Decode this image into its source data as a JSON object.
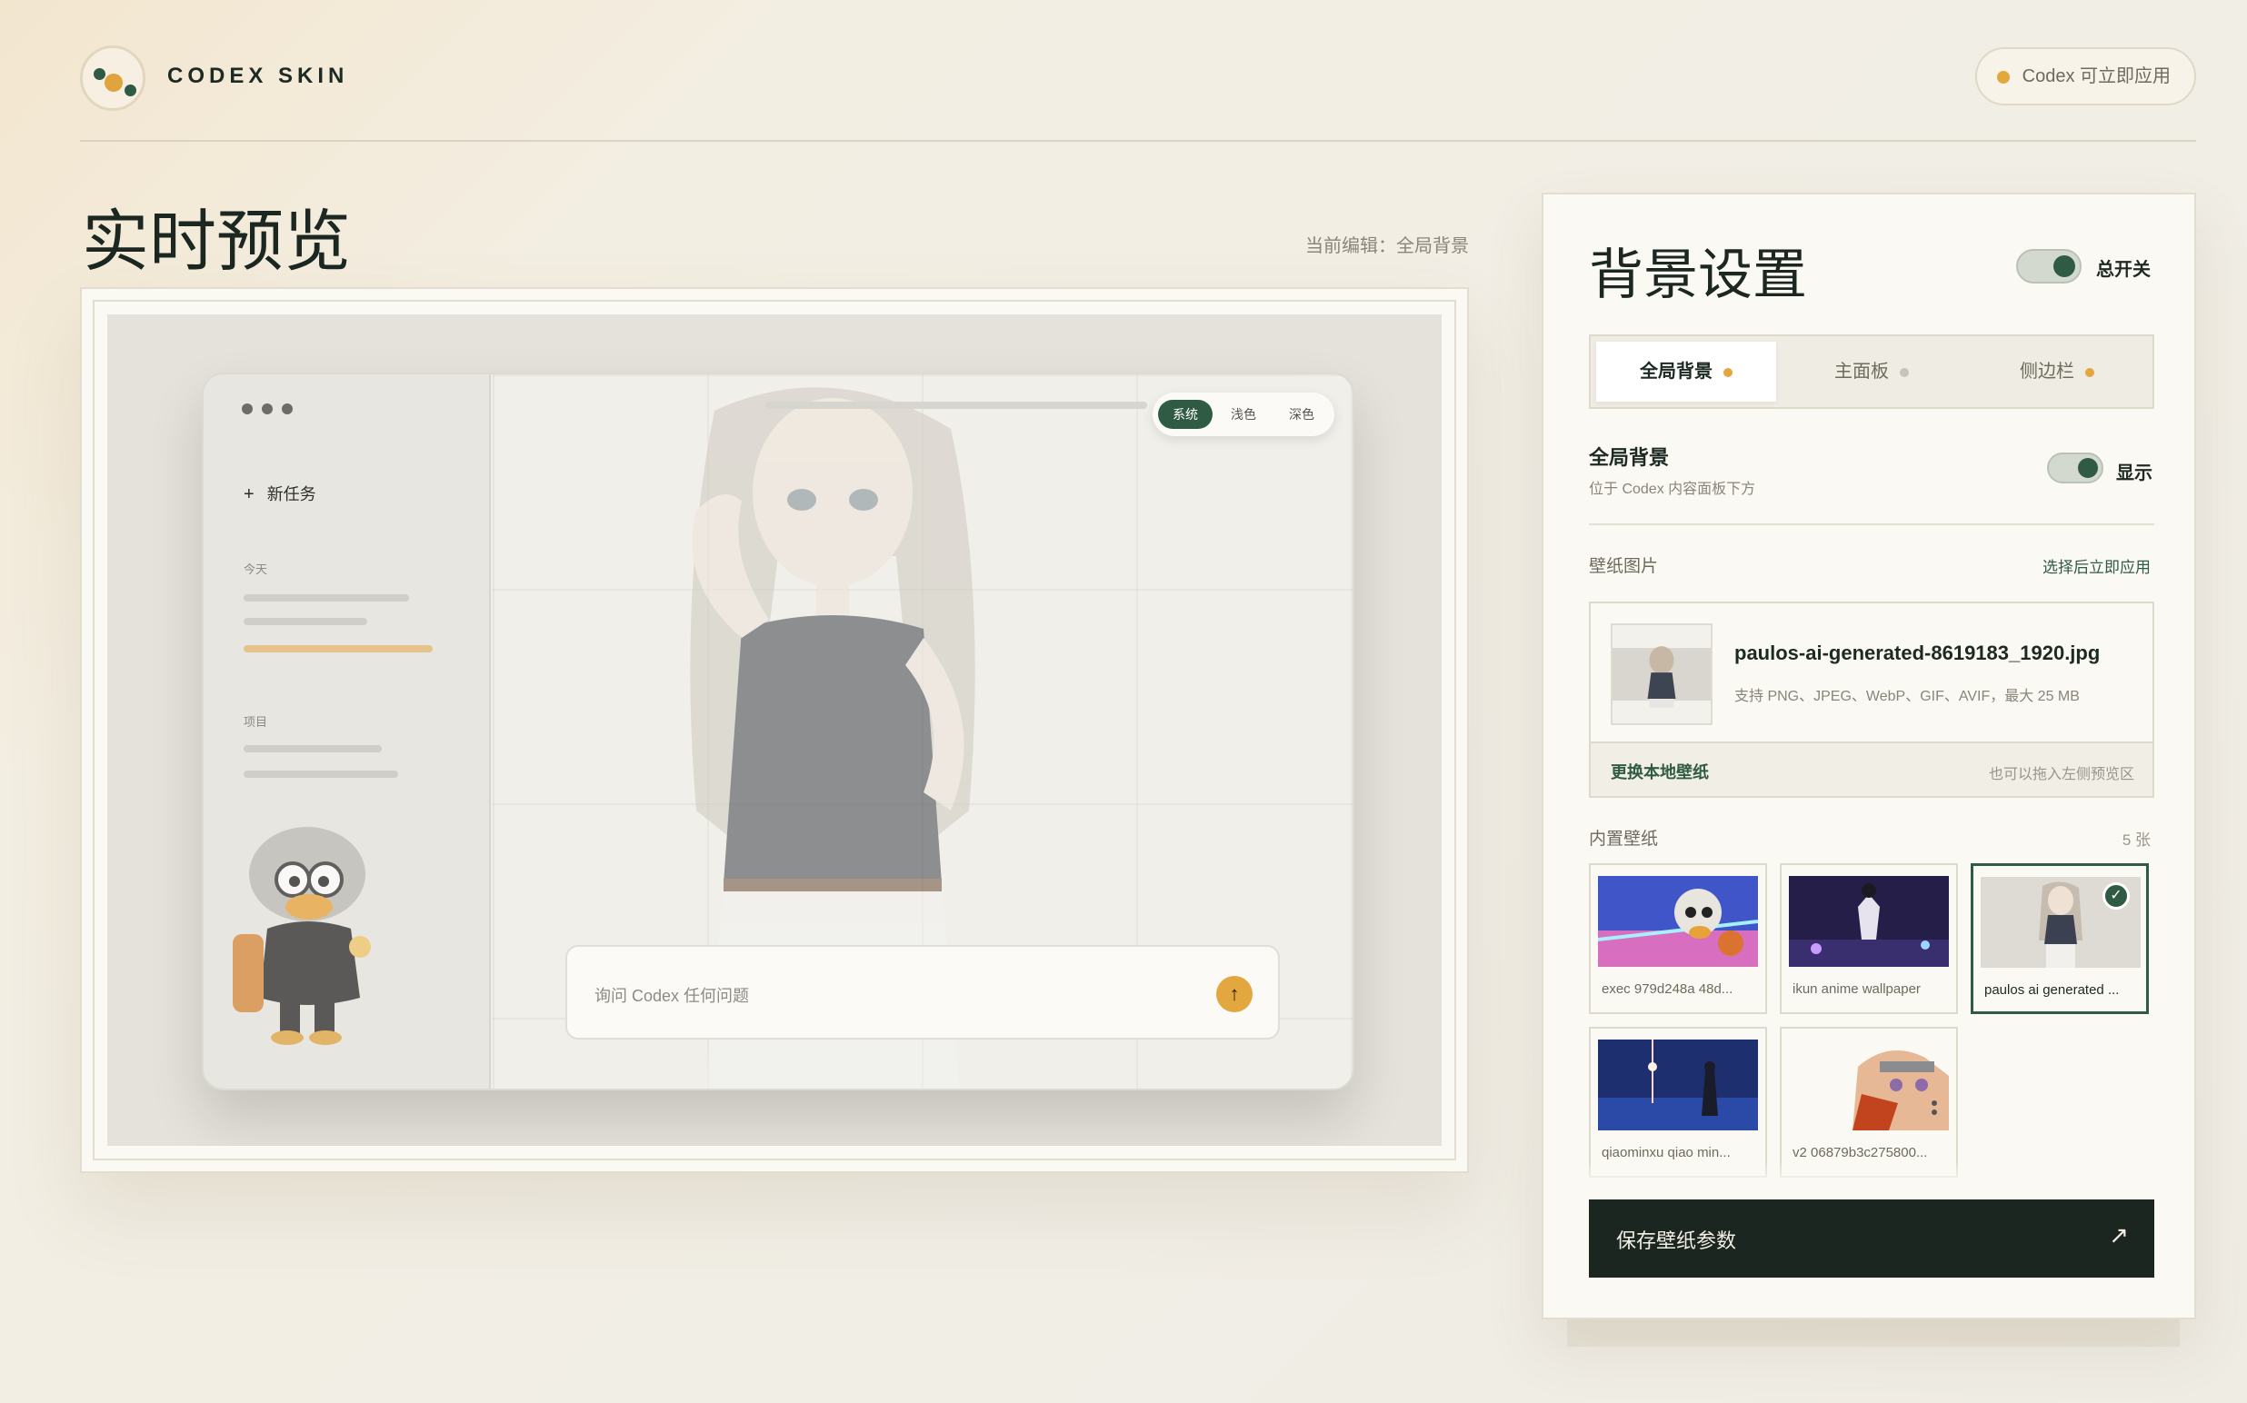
{
  "header": {
    "brand": "CODEX SKIN",
    "status": "Codex 可立即应用"
  },
  "preview": {
    "title": "实时预览",
    "editing": "当前编辑：全局背景",
    "mock": {
      "new_task": "新任务",
      "today_label": "今天",
      "projects_label": "项目",
      "theme_options": [
        "系统",
        "浅色",
        "深色"
      ],
      "ask_placeholder": "询问 Codex 任何问题",
      "send_icon": "↑"
    }
  },
  "panel": {
    "title": "背景设置",
    "master_toggle_label": "总开关",
    "tabs": [
      {
        "label": "全局背景",
        "dot_color": "#e3a740"
      },
      {
        "label": "主面板",
        "dot_color": "#c8c4ba"
      },
      {
        "label": "侧边栏",
        "dot_color": "#e3a740"
      }
    ],
    "global_bg": {
      "title": "全局背景",
      "subtitle": "位于 Codex 内容面板下方",
      "toggle_label": "显示"
    },
    "wallpaper": {
      "label": "壁纸图片",
      "action": "选择后立即应用",
      "file_name": "paulos-ai-generated-8619183_1920.jpg",
      "file_hint": "支持 PNG、JPEG、WebP、GIF、AVIF，最大 25 MB",
      "replace": "更换本地壁纸",
      "drag_hint": "也可以拖入左侧预览区"
    },
    "builtin": {
      "label": "内置壁纸",
      "count": "5 张",
      "items": [
        {
          "caption": "exec 979d248a 48d..."
        },
        {
          "caption": "ikun anime wallpaper"
        },
        {
          "caption": "paulos ai generated ..."
        },
        {
          "caption": "qiaominxu qiao min..."
        },
        {
          "caption": "v2 06879b3c275800..."
        }
      ]
    },
    "save": {
      "label": "保存壁纸参数",
      "icon": "↗"
    }
  }
}
